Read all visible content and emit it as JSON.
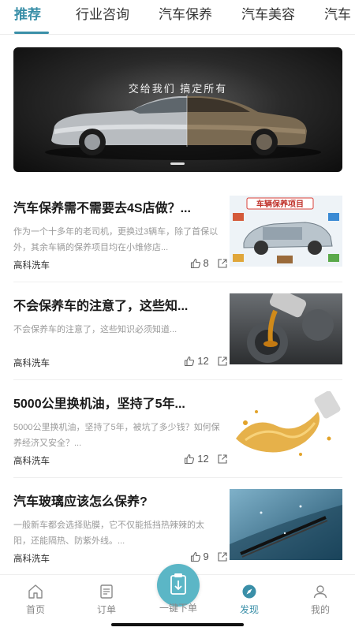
{
  "tabs": [
    "推荐",
    "行业咨询",
    "汽车保养",
    "汽车美容",
    "汽车"
  ],
  "banner": {
    "slogan": "交给我们  搞定所有"
  },
  "articles": [
    {
      "title": "汽车保养需不需要去4S店做？...",
      "desc": "作为一个十多年的老司机，更换过3辆车，除了首保以外，其余车辆的保养项目均在小维修店...",
      "source": "高科洗车",
      "likes": "8",
      "shares": "0",
      "thumb_text": "车辆保养项目",
      "thumb_icon": "car-maintenance-diagram-image"
    },
    {
      "title": "不会保养车的注意了，这些知...",
      "desc": "不会保养车的注意了，这些知识必须知道...",
      "source": "高科洗车",
      "likes": "12",
      "shares": "0",
      "thumb_icon": "engine-oil-pouring-image"
    },
    {
      "title": "5000公里换机油，坚持了5年...",
      "desc": "5000公里换机油，坚持了5年，被坑了多少钱？如何保养经济又安全？...",
      "source": "高科洗车",
      "likes": "12",
      "shares": "0",
      "thumb_icon": "oil-splash-image"
    },
    {
      "title": "汽车玻璃应该怎么保养?",
      "desc": "一般新车都会选择贴膜，它不仅能抵挡热辣辣的太阳，还能隔热、防紫外线。...",
      "source": "高科洗车",
      "likes": "9",
      "shares": "0",
      "thumb_icon": "windshield-wiper-image"
    }
  ],
  "nav": {
    "home": "首页",
    "orders": "订单",
    "one_click": "一键下单",
    "discover": "发现",
    "mine": "我的"
  },
  "colors": {
    "accent": "#3a8fa8",
    "center_button": "#5bb6c6"
  }
}
